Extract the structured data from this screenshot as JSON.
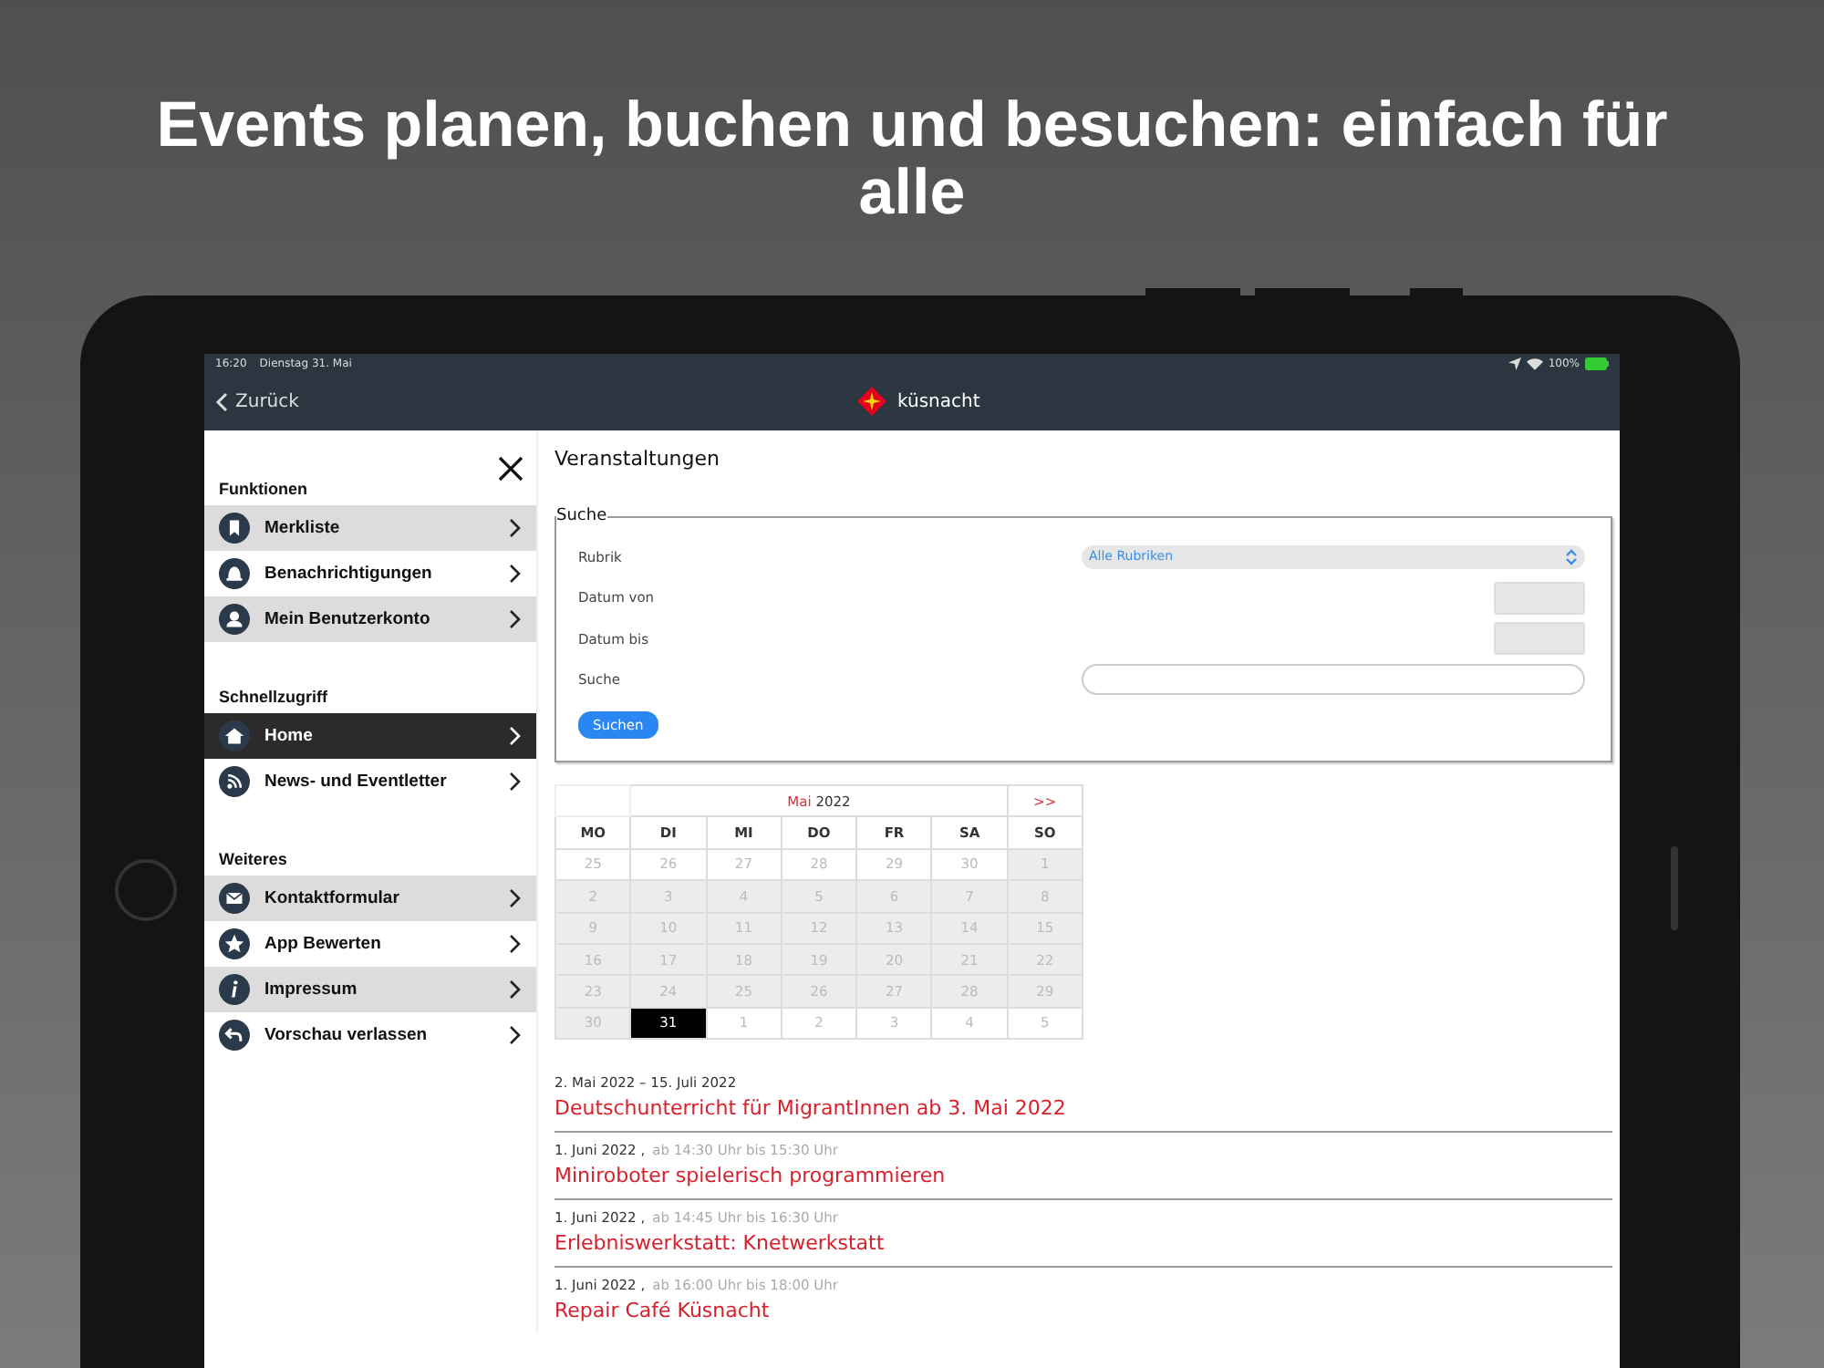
{
  "headline": "Events planen, buchen und besuchen: einfach für alle",
  "status_bar": {
    "time": "16:20",
    "date": "Dienstag 31. Mai",
    "battery": "100%"
  },
  "nav": {
    "back": "Zurück",
    "brand": "küsnacht"
  },
  "sidebar": {
    "sections": [
      {
        "title": "Funktionen",
        "items": [
          {
            "label": "Merkliste",
            "kind": "bookmark",
            "selected": false
          },
          {
            "label": "Benachrichtigungen",
            "kind": "bell",
            "selected": false
          },
          {
            "label": "Mein Benutzerkonto",
            "kind": "person",
            "selected": false
          }
        ]
      },
      {
        "title": "Schnellzugriff",
        "items": [
          {
            "label": "Home",
            "kind": "home",
            "selected": true
          },
          {
            "label": "News- und Eventletter",
            "kind": "rss",
            "selected": false
          }
        ]
      },
      {
        "title": "Weiteres",
        "items": [
          {
            "label": "Kontaktformular",
            "kind": "mail",
            "selected": false
          },
          {
            "label": "App Bewerten",
            "kind": "star",
            "selected": false
          },
          {
            "label": "Impressum",
            "kind": "info",
            "selected": false
          },
          {
            "label": "Vorschau verlassen",
            "kind": "back",
            "selected": false
          }
        ]
      }
    ]
  },
  "page_title": "Veranstaltungen",
  "search_form": {
    "legend": "Suche",
    "rubrik_label": "Rubrik",
    "rubrik_value": "Alle Rubriken",
    "from_label": "Datum von",
    "to_label": "Datum bis",
    "search_label": "Suche",
    "button": "Suchen"
  },
  "calendar": {
    "month": "Mai",
    "year": "2022",
    "next": ">>",
    "weekdays": [
      "MO",
      "DI",
      "MI",
      "DO",
      "FR",
      "SA",
      "SO"
    ],
    "days": [
      {
        "day": "25",
        "kind": "other",
        "selected": false
      },
      {
        "day": "26",
        "kind": "other",
        "selected": false
      },
      {
        "day": "27",
        "kind": "other",
        "selected": false
      },
      {
        "day": "28",
        "kind": "other",
        "selected": false
      },
      {
        "day": "29",
        "kind": "other",
        "selected": false
      },
      {
        "day": "30",
        "kind": "other",
        "selected": false
      },
      {
        "day": "1",
        "kind": "past",
        "selected": false
      },
      {
        "day": "2",
        "kind": "past",
        "selected": false
      },
      {
        "day": "3",
        "kind": "past",
        "selected": false
      },
      {
        "day": "4",
        "kind": "past",
        "selected": false
      },
      {
        "day": "5",
        "kind": "past",
        "selected": false
      },
      {
        "day": "6",
        "kind": "past",
        "selected": false
      },
      {
        "day": "7",
        "kind": "past",
        "selected": false
      },
      {
        "day": "8",
        "kind": "past",
        "selected": false
      },
      {
        "day": "9",
        "kind": "past",
        "selected": false
      },
      {
        "day": "10",
        "kind": "past",
        "selected": false
      },
      {
        "day": "11",
        "kind": "past",
        "selected": false
      },
      {
        "day": "12",
        "kind": "past",
        "selected": false
      },
      {
        "day": "13",
        "kind": "past",
        "selected": false
      },
      {
        "day": "14",
        "kind": "past",
        "selected": false
      },
      {
        "day": "15",
        "kind": "past",
        "selected": false
      },
      {
        "day": "16",
        "kind": "past",
        "selected": false
      },
      {
        "day": "17",
        "kind": "past",
        "selected": false
      },
      {
        "day": "18",
        "kind": "past",
        "selected": false
      },
      {
        "day": "19",
        "kind": "past",
        "selected": false
      },
      {
        "day": "20",
        "kind": "past",
        "selected": false
      },
      {
        "day": "21",
        "kind": "past",
        "selected": false
      },
      {
        "day": "22",
        "kind": "past",
        "selected": false
      },
      {
        "day": "23",
        "kind": "past",
        "selected": false
      },
      {
        "day": "24",
        "kind": "past",
        "selected": false
      },
      {
        "day": "25",
        "kind": "past",
        "selected": false
      },
      {
        "day": "26",
        "kind": "past",
        "selected": false
      },
      {
        "day": "27",
        "kind": "past",
        "selected": false
      },
      {
        "day": "28",
        "kind": "past",
        "selected": false
      },
      {
        "day": "29",
        "kind": "past",
        "selected": false
      },
      {
        "day": "30",
        "kind": "past",
        "selected": false
      },
      {
        "day": "31",
        "kind": "current",
        "selected": true
      },
      {
        "day": "1",
        "kind": "other",
        "selected": false
      },
      {
        "day": "2",
        "kind": "other",
        "selected": false
      },
      {
        "day": "3",
        "kind": "other",
        "selected": false
      },
      {
        "day": "4",
        "kind": "other",
        "selected": false
      },
      {
        "day": "5",
        "kind": "other",
        "selected": false
      }
    ]
  },
  "events": [
    {
      "date": "2. Mai 2022 – 15. Juli 2022",
      "title": "Deutschunterricht für MigrantInnen ab 3. Mai 2022"
    },
    {
      "date": "1. Juni 2022 ,",
      "time": "ab 14:30 Uhr bis 15:30 Uhr",
      "title": "Miniroboter spielerisch programmieren"
    },
    {
      "date": "1. Juni 2022 ,",
      "time": "ab 14:45 Uhr bis 16:30 Uhr",
      "title": "Erlebniswerkstatt: Knetwerkstatt"
    },
    {
      "date": "1. Juni 2022 ,",
      "time": "ab 16:00 Uhr bis 18:00 Uhr",
      "title": "Repair Café Küsnacht"
    }
  ]
}
